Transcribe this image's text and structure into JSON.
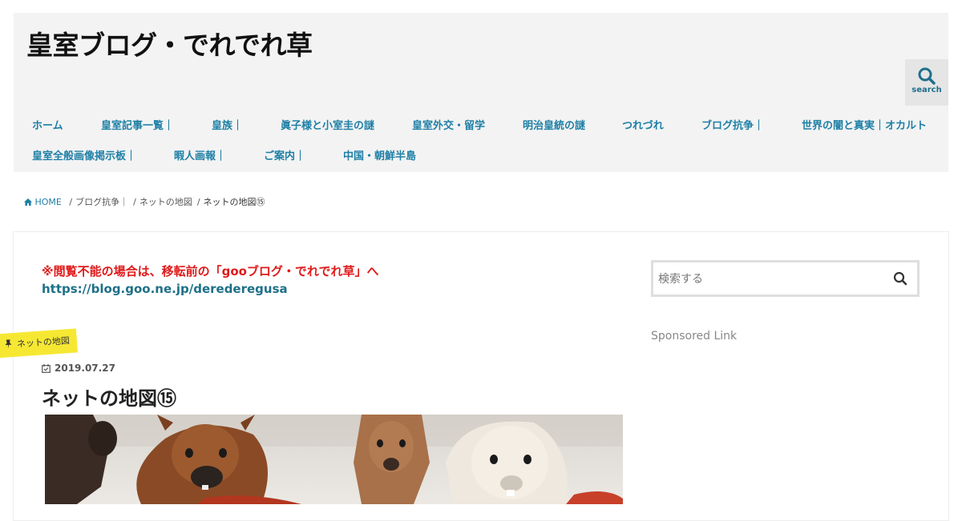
{
  "site": {
    "title": "皇室ブログ・でれでれ草"
  },
  "search_button": {
    "label": "search"
  },
  "nav": {
    "row1": [
      "ホーム",
      "皇室記事一覧｜",
      "皇族｜",
      "眞子様と小室圭の謎",
      "皇室外交・留学",
      "明治皇統の謎",
      "つれづれ",
      "ブログ抗争｜",
      "世界の闇と真実｜オカルト"
    ],
    "row2": [
      "皇室全般画像掲示板｜",
      "暇人画報｜",
      "ご案内｜",
      "中国・朝鮮半島"
    ]
  },
  "breadcrumb": [
    "HOME",
    "ブログ抗争｜",
    "ネットの地図",
    "ネットの地図⑮"
  ],
  "notice": {
    "text": "※閲覧不能の場合は、移転前の「gooブログ・でれでれ草」へ",
    "link": "https://blog.goo.ne.jp/derederegusa"
  },
  "post": {
    "category": "ネットの地図",
    "date": "2019.07.27",
    "title": "ネットの地図⑮"
  },
  "sidebar": {
    "search_placeholder": "検索する",
    "sponsored": "Sponsored Link"
  },
  "icons": {
    "search": "search-icon",
    "home": "home-icon",
    "calendar": "calendar-icon",
    "pin": "pin-icon"
  },
  "colors": {
    "accent": "#1e7fa6",
    "notice_red": "#e01a1a",
    "tag_yellow": "#f6e832",
    "header_bg": "#f3f3f3"
  }
}
